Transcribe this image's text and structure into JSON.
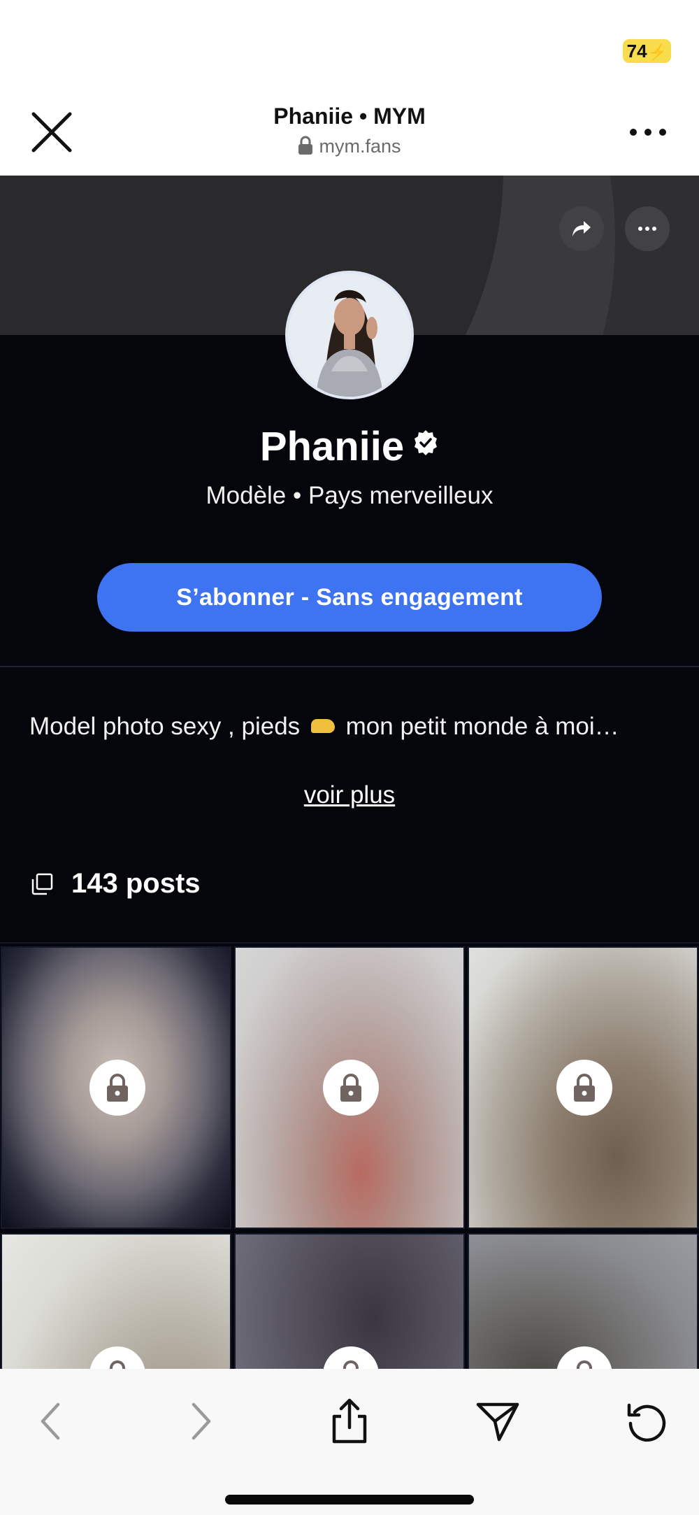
{
  "status_bar": {
    "battery_level": "74",
    "battery_color": "#f7dc4b"
  },
  "browser": {
    "title": "Phaniie • MYM",
    "url": "mym.fans"
  },
  "profile": {
    "name": "Phaniie",
    "subtitle": "Modèle • Pays merveilleux",
    "subscribe_label": "S’abonner - Sans engagement",
    "bio": "Model photo sexy , pieds",
    "bio_end": "mon petit monde à moi…",
    "see_more": "voir plus",
    "posts_count": "143 posts",
    "accent_color": "#3e73f1"
  },
  "grid": {
    "tiles": [
      {
        "locked": true,
        "icon": "lock-icon"
      },
      {
        "locked": true,
        "icon": "lock-icon"
      },
      {
        "locked": true,
        "icon": "lock-icon"
      },
      {
        "locked": true,
        "icon": "lock-icon"
      },
      {
        "locked": true,
        "icon": "lock-icon"
      },
      {
        "locked": true,
        "icon": "lock-icon"
      }
    ]
  },
  "toolbar": {
    "icons": [
      "back-arrow-icon",
      "forward-arrow-icon",
      "share-icon",
      "send-icon",
      "reload-icon"
    ]
  }
}
